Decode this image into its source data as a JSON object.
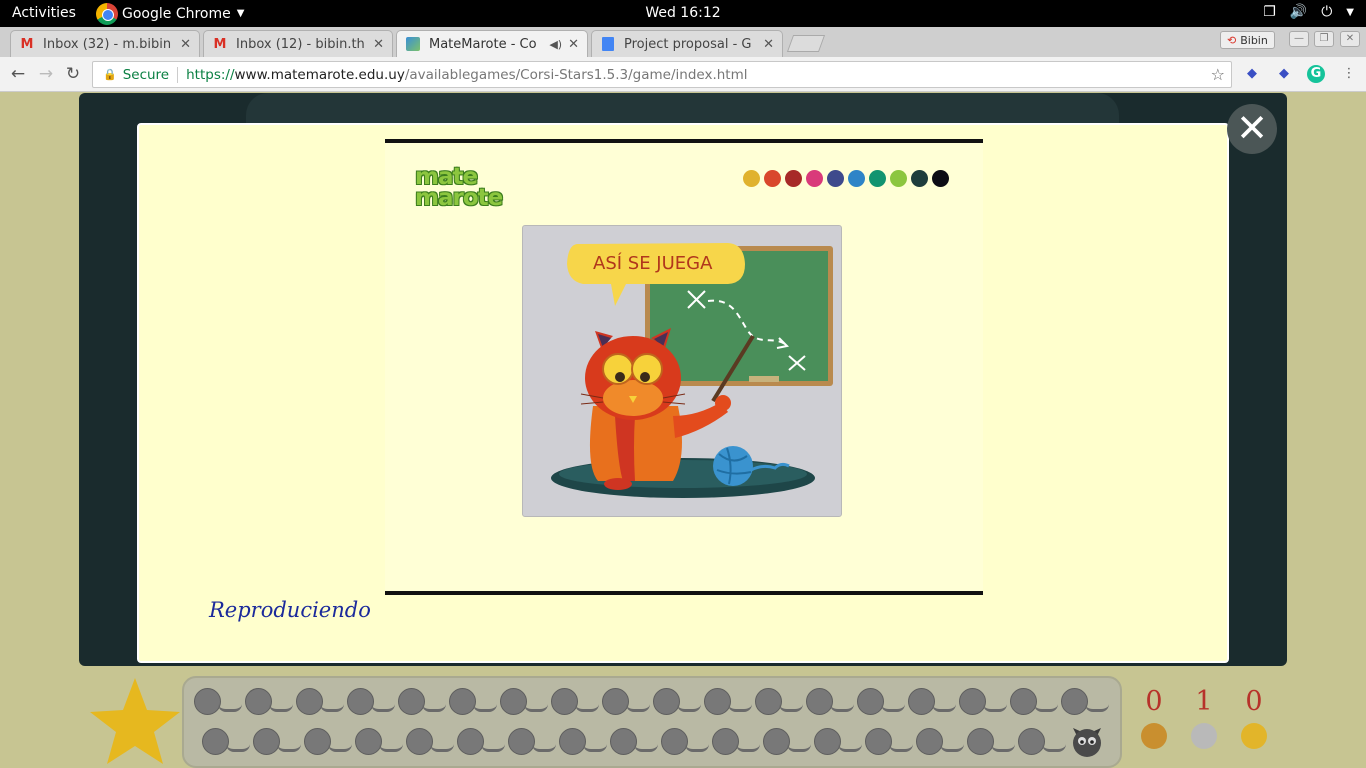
{
  "topbar": {
    "activities": "Activities",
    "app_name": "Google Chrome",
    "clock": "Wed 16:12"
  },
  "tabs": [
    {
      "title": "Inbox (32) - m.bibin",
      "icon": "gmail-icon"
    },
    {
      "title": "Inbox (12) - bibin.th",
      "icon": "gmail-icon"
    },
    {
      "title": "MateMarote - Co",
      "icon": "matemarote-icon",
      "active": true
    },
    {
      "title": "Project proposal - G",
      "icon": "docs-icon"
    }
  ],
  "profile": {
    "name": "Bibin"
  },
  "address": {
    "secure_label": "Secure",
    "scheme": "https://",
    "host": "www.matemarote.edu.uy",
    "path": "/availablegames/Corsi-Stars1.5.3/game/index.html"
  },
  "video": {
    "logo_line1": "mate",
    "logo_line2": "marote",
    "bubble_text": "ASÍ  SE JUEGA",
    "palette": [
      "#e0b22e",
      "#d9472c",
      "#a72a28",
      "#d93a7a",
      "#3e4a8c",
      "#2e84c7",
      "#129470",
      "#8cc63f",
      "#1e3d3c",
      "#0c0c14"
    ]
  },
  "modal": {
    "status_text": "Reproduciendo"
  },
  "scores": [
    {
      "value": "0",
      "medal_color": "#c98f2f"
    },
    {
      "value": "1",
      "medal_color": "#b9b9b9"
    },
    {
      "value": "0",
      "medal_color": "#e2b52a"
    }
  ],
  "colors": {
    "page_bg": "#c7c592",
    "frame_bg": "#1a2b2d",
    "modal_bg": "#ffffcd",
    "status_text": "#1b2a9b"
  }
}
